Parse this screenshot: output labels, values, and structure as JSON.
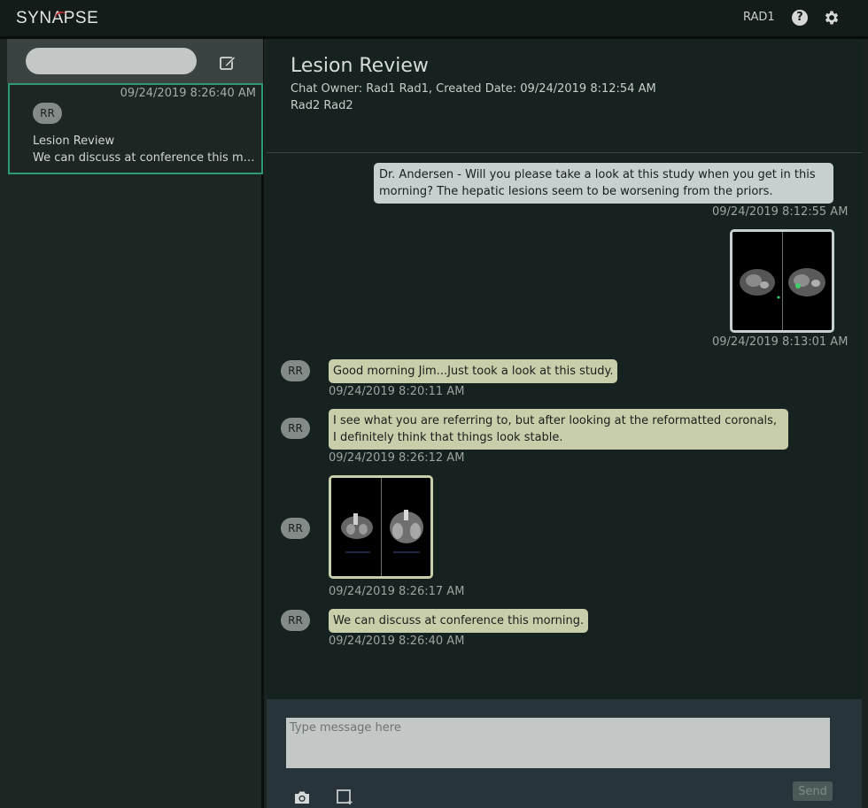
{
  "app": {
    "logo": "SYNAPSE",
    "user": "RAD1",
    "help_icon": "help-icon",
    "settings_icon": "gear-icon"
  },
  "sidebar": {
    "search_placeholder": "",
    "compose_icon": "compose-icon",
    "chats": [
      {
        "time": "09/24/2019 8:26:40 AM",
        "avatar": "RR",
        "title": "Lesion Review",
        "preview": "We can discuss at conference this morning."
      }
    ]
  },
  "chat": {
    "title": "Lesion Review",
    "meta": "Chat Owner: Rad1 Rad1, Created Date: 09/24/2019 8:12:54 AM",
    "participants": "Rad2 Rad2",
    "messages": [
      {
        "direction": "out",
        "text": "Dr. Andersen - Will you please take a look at this study when you get in this morning? The hepatic lesions seem to be worsening from the priors.",
        "time": "09/24/2019 8:12:55 AM"
      },
      {
        "direction": "out",
        "image": "ct-axial-thumbnail",
        "time": "09/24/2019 8:13:01 AM"
      },
      {
        "direction": "in",
        "avatar": "RR",
        "text": "Good morning Jim...Just took a look at this study.",
        "time": "09/24/2019 8:20:11 AM"
      },
      {
        "direction": "in",
        "avatar": "RR",
        "text": "I see what you are referring to, but after looking at the reformatted coronals, I definitely think that things look stable.",
        "time": "09/24/2019 8:26:12 AM"
      },
      {
        "direction": "in",
        "avatar": "RR",
        "image": "ct-coronal-thumbnail",
        "time": "09/24/2019 8:26:17 AM"
      },
      {
        "direction": "in",
        "avatar": "RR",
        "text": "We can discuss at conference this morning.",
        "time": "09/24/2019 8:26:40 AM"
      }
    ]
  },
  "composer": {
    "placeholder": "Type message here",
    "camera_icon": "camera-icon",
    "crop_icon": "crop-icon",
    "send_label": "Send"
  },
  "colors": {
    "accent": "#2e9a73",
    "brand_red": "#c4282c",
    "outgoing_bubble": "#c7cfd1",
    "incoming_bubble": "#c9ceaa"
  }
}
